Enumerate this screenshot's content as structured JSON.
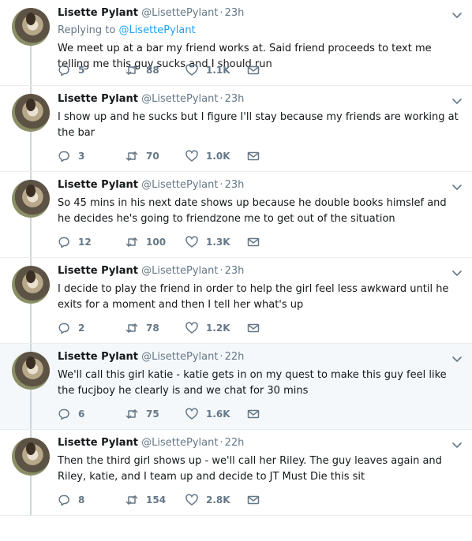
{
  "tweets": [
    {
      "name": "Lisette Pylant",
      "handle": "@LisettePylant",
      "time": "23h",
      "reply_prefix": "Replying to ",
      "reply_to": "@LisettePylant",
      "text": "We meet up at a bar my friend works at. Said friend proceeds to text me telling me this guy sucks and I should run",
      "replies": "5",
      "retweets": "88",
      "likes": "1.1K",
      "highlighted": false
    },
    {
      "name": "Lisette Pylant",
      "handle": "@LisettePylant",
      "time": "23h",
      "text": "I show up and he sucks but I figure I'll stay because my friends are working at the bar",
      "replies": "3",
      "retweets": "70",
      "likes": "1.0K",
      "highlighted": false
    },
    {
      "name": "Lisette Pylant",
      "handle": "@LisettePylant",
      "time": "23h",
      "text": "So 45 mins in his next date shows up because he double books himslef and he decides he's going to friendzone me to get out of the situation",
      "replies": "12",
      "retweets": "100",
      "likes": "1.3K",
      "highlighted": false
    },
    {
      "name": "Lisette Pylant",
      "handle": "@LisettePylant",
      "time": "23h",
      "text": "I decide to play the friend in order to help the girl feel less awkward until he exits for a moment and then I tell her what's up",
      "replies": "2",
      "retweets": "78",
      "likes": "1.2K",
      "highlighted": false
    },
    {
      "name": "Lisette Pylant",
      "handle": "@LisettePylant",
      "time": "22h",
      "text": "We'll call this girl katie - katie gets in on my quest to make this guy feel like the fucjboy he clearly is and we chat for 30 mins",
      "replies": "6",
      "retweets": "75",
      "likes": "1.6K",
      "highlighted": true
    },
    {
      "name": "Lisette Pylant",
      "handle": "@LisettePylant",
      "time": "22h",
      "text": "Then the third girl shows up - we'll call her Riley. The guy leaves again and Riley, katie, and I team up and decide to JT Must Die this sit",
      "replies": "8",
      "retweets": "154",
      "likes": "2.8K",
      "highlighted": false
    }
  ],
  "icons": {
    "reply": "reply-icon",
    "retweet": "retweet-icon",
    "like": "heart-icon",
    "dm": "envelope-icon",
    "more": "chevron-down-icon"
  },
  "colors": {
    "link": "#1da1f2",
    "secondary_text": "#657786",
    "thread_line": "#ccd6dd",
    "highlight_bg": "#f5f8fa"
  }
}
